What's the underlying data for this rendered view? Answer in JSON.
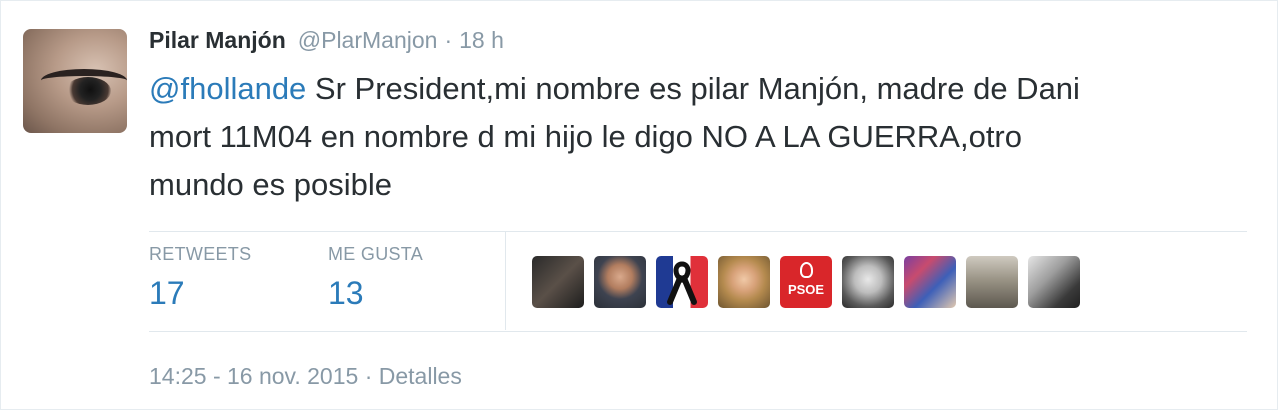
{
  "tweet": {
    "author_name": "Pilar Manjón",
    "author_handle": "@PlarManjon",
    "separator": "·",
    "relative_time": "18 h",
    "mention": "@fhollande",
    "text_line1": " Sr President,mi nombre es pilar Manjón, madre de Dani",
    "text_line2": "mort 11M04 en nombre d mi hijo le digo NO A LA GUERRA,otro",
    "text_line3": "mundo es posible"
  },
  "stats": {
    "retweets_label": "RETWEETS",
    "retweets_value": "17",
    "likes_label": "ME GUSTA",
    "likes_value": "13"
  },
  "likers": [
    {
      "icon": "user-avatar-1"
    },
    {
      "icon": "user-avatar-2"
    },
    {
      "icon": "user-avatar-french-flag-ribbon"
    },
    {
      "icon": "user-avatar-4"
    },
    {
      "icon": "user-avatar-psoe",
      "text": "PSOE"
    },
    {
      "icon": "user-avatar-6"
    },
    {
      "icon": "user-avatar-7"
    },
    {
      "icon": "user-avatar-8"
    },
    {
      "icon": "user-avatar-9"
    }
  ],
  "footer": {
    "timestamp": "14:25 - 16 nov. 2015",
    "separator": "·",
    "details_label": "Detalles"
  },
  "colors": {
    "accent": "#2b7bb9",
    "muted": "#8899a6",
    "text": "#292f33",
    "divider": "#e1e8ed"
  }
}
